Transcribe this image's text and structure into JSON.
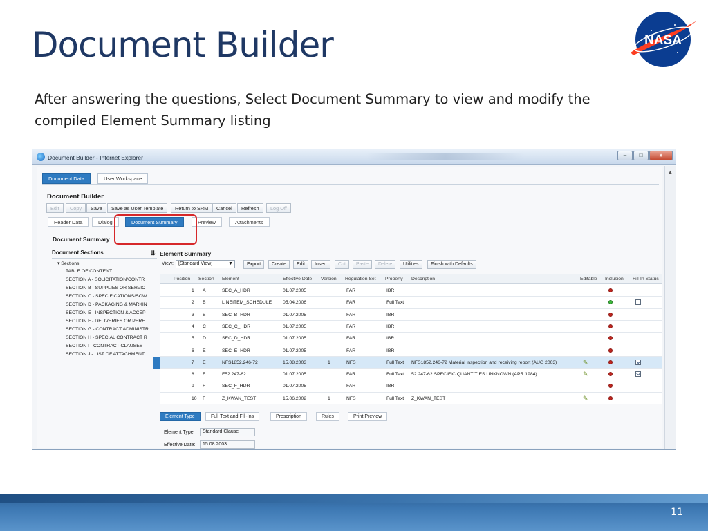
{
  "slide": {
    "title": "Document Builder",
    "body": "After answering the questions, Select Document Summary to view and modify the compiled Element Summary listing",
    "page_number": "11",
    "logo_text": "NASA"
  },
  "window": {
    "title": "Document Builder - Internet Explorer",
    "controls": {
      "minimize": "–",
      "maximize": "□",
      "close": "x"
    }
  },
  "app": {
    "top_tabs": [
      "Document Data",
      "User Workspace"
    ],
    "heading": "Document Builder",
    "toolbar": [
      "Edit",
      "Copy",
      "Save",
      "Save as User Template",
      "Return to SRM",
      "Cancel",
      "Refresh",
      "Log Off"
    ],
    "sub_tabs": [
      "Header Data",
      "Dialog",
      "Document Summary",
      "Preview",
      "Attachments"
    ],
    "summary_label": "Document Summary",
    "sections": {
      "title": "Document Sections",
      "root": "▾ Sections",
      "items": [
        "TABLE OF CONTENT",
        "SECTION A - SOLICITATION/CONTR",
        "SECTION B - SUPPLIES OR SERVIC",
        "SECTION C - SPECIFICATIONS/SOW",
        "SECTION D - PACKAGING & MARKIN",
        "SECTION E - INSPECTION & ACCEP",
        "SECTION F - DELIVERIES OR PERF",
        "SECTION G - CONTRACT ADMINISTR",
        "SECTION H - SPECIAL CONTRACT R",
        "SECTION I - CONTRACT CLAUSES",
        "SECTION J - LIST OF ATTACHMENT"
      ]
    },
    "element_summary": {
      "title": "Element Summary",
      "view_label": "View:",
      "view_value": "[Standard View]",
      "buttons": [
        "Export",
        "Create",
        "Edit",
        "Insert",
        "Cut",
        "Paste",
        "Delete",
        "Utilities",
        "Finish with Defaults"
      ],
      "columns": [
        "Position",
        "Section",
        "Element",
        "Effective Date",
        "Version",
        "Regulation Set",
        "Property",
        "Description",
        "Editable",
        "Inclusion",
        "Fill-In Status"
      ],
      "rows": [
        {
          "position": "1",
          "section": "A",
          "element": "SEC_A_HDR",
          "date": "01.07.2005",
          "version": "",
          "reg": "FAR",
          "property": "IBR",
          "description": "",
          "editable": false,
          "inclusion": "red",
          "fill": ""
        },
        {
          "position": "2",
          "section": "B",
          "element": "LINEITEM_SCHEDULE",
          "date": "05.04.2006",
          "version": "",
          "reg": "FAR",
          "property": "Full Text",
          "description": "",
          "editable": false,
          "inclusion": "green",
          "fill": "off"
        },
        {
          "position": "3",
          "section": "B",
          "element": "SEC_B_HDR",
          "date": "01.07.2005",
          "version": "",
          "reg": "FAR",
          "property": "IBR",
          "description": "",
          "editable": false,
          "inclusion": "red",
          "fill": ""
        },
        {
          "position": "4",
          "section": "C",
          "element": "SEC_C_HDR",
          "date": "01.07.2005",
          "version": "",
          "reg": "FAR",
          "property": "IBR",
          "description": "",
          "editable": false,
          "inclusion": "red",
          "fill": ""
        },
        {
          "position": "5",
          "section": "D",
          "element": "SEC_D_HDR",
          "date": "01.07.2005",
          "version": "",
          "reg": "FAR",
          "property": "IBR",
          "description": "",
          "editable": false,
          "inclusion": "red",
          "fill": ""
        },
        {
          "position": "6",
          "section": "E",
          "element": "SEC_E_HDR",
          "date": "01.07.2005",
          "version": "",
          "reg": "FAR",
          "property": "IBR",
          "description": "",
          "editable": false,
          "inclusion": "red",
          "fill": ""
        },
        {
          "position": "7",
          "section": "E",
          "element": "NFS1852.246-72",
          "date": "15.08.2003",
          "version": "1",
          "reg": "NFS",
          "property": "Full Text",
          "description": "NFS1852.246-72 Material inspection and receiving report (AUG 2003)",
          "editable": true,
          "inclusion": "red",
          "fill": "on",
          "selected": true
        },
        {
          "position": "8",
          "section": "F",
          "element": "F52.247-62",
          "date": "01.07.2005",
          "version": "",
          "reg": "FAR",
          "property": "Full Text",
          "description": "52.247-62 SPECIFIC QUANTITIES UNKNOWN (APR 1984)",
          "editable": true,
          "inclusion": "red",
          "fill": "on"
        },
        {
          "position": "9",
          "section": "F",
          "element": "SEC_F_HDR",
          "date": "01.07.2005",
          "version": "",
          "reg": "FAR",
          "property": "IBR",
          "description": "",
          "editable": false,
          "inclusion": "red",
          "fill": ""
        },
        {
          "position": "10",
          "section": "F",
          "element": "Z_KWAN_TEST",
          "date": "15.06.2002",
          "version": "1",
          "reg": "NFS",
          "property": "Full Text",
          "description": "Z_KWAN_TEST",
          "editable": true,
          "inclusion": "red",
          "fill": ""
        }
      ],
      "bottom_tabs": [
        "Element Type",
        "Full Text and Fill-Ins",
        "Prescription",
        "Rules",
        "Print Preview"
      ],
      "element_type_label": "Element Type:",
      "element_type_value": "Standard Clause",
      "effective_date_label": "Effective Date:",
      "effective_date_value": "15.08.2003"
    }
  },
  "colors": {
    "title": "#1f3864",
    "accent": "#2f7bc1",
    "highlight": "#d6282a"
  }
}
